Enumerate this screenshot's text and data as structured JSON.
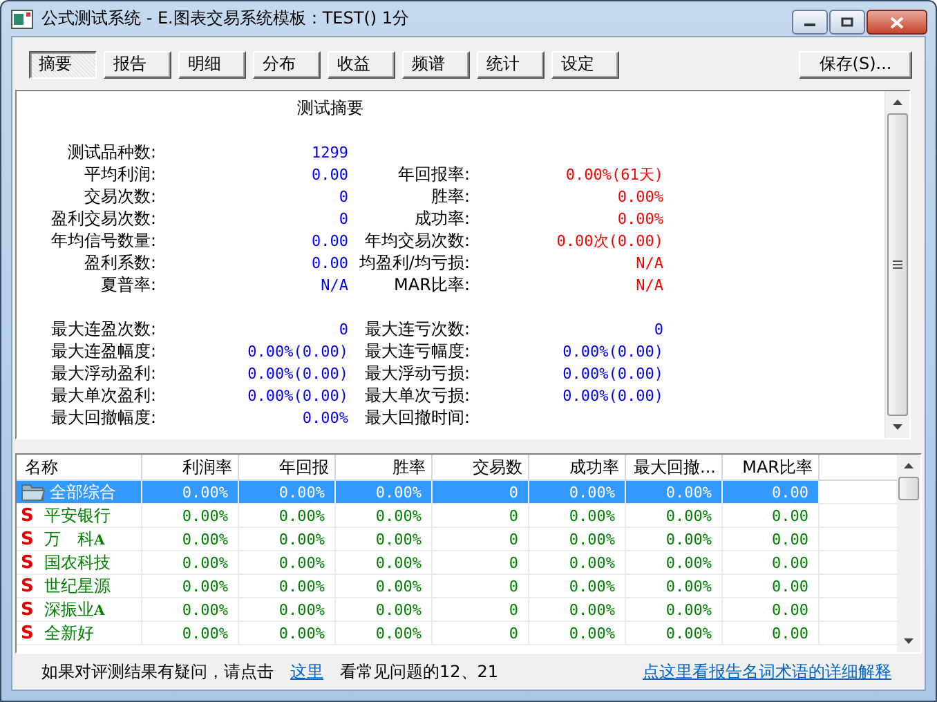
{
  "window": {
    "title": "公式测试系统 - E.图表交易系统模板：TEST() 1分"
  },
  "tabs": [
    {
      "label": "摘要",
      "selected": true
    },
    {
      "label": "报告",
      "selected": false
    },
    {
      "label": "明细",
      "selected": false
    },
    {
      "label": "分布",
      "selected": false
    },
    {
      "label": "收益",
      "selected": false
    },
    {
      "label": "频谱",
      "selected": false
    },
    {
      "label": "统计",
      "selected": false
    },
    {
      "label": "设定",
      "selected": false
    }
  ],
  "save_button": "保存(S)...",
  "summary": {
    "title": "测试摘要",
    "sections": [
      [
        {
          "label": "测试品种数:",
          "value": "1299",
          "color": "#0000ff"
        },
        {
          "label": "平均利润:",
          "value": "0.00",
          "color": "#0000ff",
          "right": {
            "label": "年回报率:",
            "value": "0.00%(61天)",
            "color": "#ff0000"
          }
        },
        {
          "label": "交易次数:",
          "value": "0",
          "color": "#0000ff",
          "right": {
            "label": "胜率:",
            "value": "0.00%",
            "color": "#ff0000"
          }
        },
        {
          "label": "盈利交易次数:",
          "value": "0",
          "color": "#0000ff",
          "right": {
            "label": "成功率:",
            "value": "0.00%",
            "color": "#ff0000"
          }
        },
        {
          "label": "年均信号数量:",
          "value": "0.00",
          "color": "#0000ff",
          "right": {
            "label": "年均交易次数:",
            "value": "0.00次(0.00)",
            "color": "#ff0000"
          }
        },
        {
          "label": "盈利系数:",
          "value": "0.00",
          "color": "#0000ff",
          "right": {
            "label": "均盈利/均亏损:",
            "value": "N/A",
            "color": "#ff0000"
          }
        },
        {
          "label": "夏普率:",
          "value": "N/A",
          "color": "#0000ff",
          "right": {
            "label": "MAR比率:",
            "value": "N/A",
            "color": "#ff0000"
          }
        }
      ],
      [
        {
          "label": "最大连盈次数:",
          "value": "0",
          "color": "#0000ff",
          "right": {
            "label": "最大连亏次数:",
            "value": "0",
            "color": "#0000ff"
          }
        },
        {
          "label": "最大连盈幅度:",
          "value": "0.00%(0.00)",
          "color": "#0000ff",
          "right": {
            "label": "最大连亏幅度:",
            "value": "0.00%(0.00)",
            "color": "#0000ff"
          }
        },
        {
          "label": "最大浮动盈利:",
          "value": "0.00%(0.00)",
          "color": "#0000ff",
          "right": {
            "label": "最大浮动亏损:",
            "value": "0.00%(0.00)",
            "color": "#0000ff"
          }
        },
        {
          "label": "最大单次盈利:",
          "value": "0.00%(0.00)",
          "color": "#0000ff",
          "right": {
            "label": "最大单次亏损:",
            "value": "0.00%(0.00)",
            "color": "#0000ff"
          }
        },
        {
          "label": "最大回撤幅度:",
          "value": "0.00%",
          "color": "#0000ff",
          "right": {
            "label": "最大回撤时间:"
          }
        }
      ]
    ]
  },
  "table": {
    "columns": [
      "名称",
      "利润率",
      "年回报",
      "胜率",
      "交易数",
      "成功率",
      "最大回撤...",
      "MAR比率"
    ],
    "rows": [
      {
        "kind": "folder",
        "selected": true,
        "cells": [
          "全部综合",
          "0.00%",
          "0.00%",
          "0.00%",
          "0",
          "0.00%",
          "0.00%",
          "0.00"
        ]
      },
      {
        "kind": "stock",
        "marker": "S",
        "selected": false,
        "cells": [
          "平安银行",
          "0.00%",
          "0.00%",
          "0.00%",
          "0",
          "0.00%",
          "0.00%",
          "0.00"
        ]
      },
      {
        "kind": "stock",
        "marker": "S",
        "selected": false,
        "cells": [
          "万　科**A**",
          "0.00%",
          "0.00%",
          "0.00%",
          "0",
          "0.00%",
          "0.00%",
          "0.00"
        ]
      },
      {
        "kind": "stock",
        "marker": "S",
        "selected": false,
        "cells": [
          "国农科技",
          "0.00%",
          "0.00%",
          "0.00%",
          "0",
          "0.00%",
          "0.00%",
          "0.00"
        ]
      },
      {
        "kind": "stock",
        "marker": "S",
        "selected": false,
        "cells": [
          "世纪星源",
          "0.00%",
          "0.00%",
          "0.00%",
          "0",
          "0.00%",
          "0.00%",
          "0.00"
        ]
      },
      {
        "kind": "stock",
        "marker": "S",
        "selected": false,
        "cells": [
          "深振业**A**",
          "0.00%",
          "0.00%",
          "0.00%",
          "0",
          "0.00%",
          "0.00%",
          "0.00"
        ]
      },
      {
        "kind": "stock",
        "marker": "S",
        "selected": false,
        "cells": [
          "全新好",
          "0.00%",
          "0.00%",
          "0.00%",
          "0",
          "0.00%",
          "0.00%",
          "0.00"
        ]
      }
    ]
  },
  "status_bar": {
    "text": "如果对评测结果有疑问，请点击",
    "link": "这里",
    "text_2": "看常见问题的12、21",
    "help_link": "点这里看报告名词术语的详细解释"
  }
}
